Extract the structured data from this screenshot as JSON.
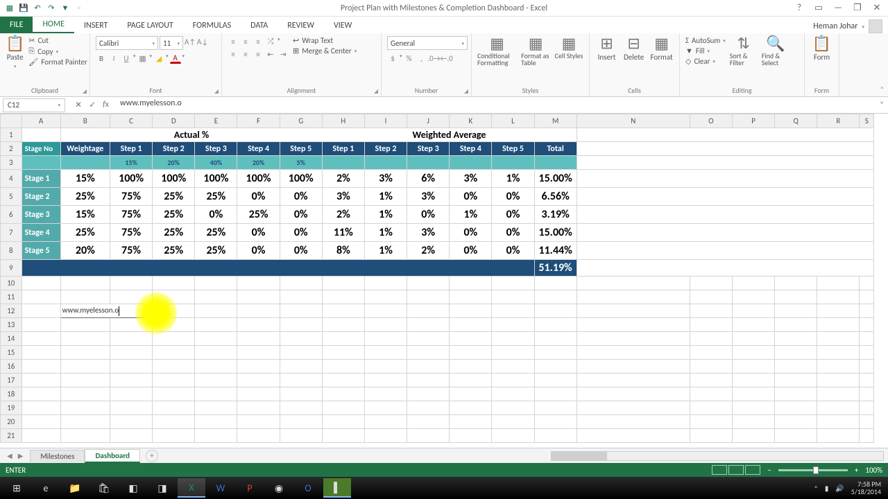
{
  "app": {
    "title": "Project Plan with Milestones & Completion Dashboard - Excel",
    "user": "Heman Johar"
  },
  "tabs": {
    "file": "FILE",
    "items": [
      "HOME",
      "INSERT",
      "PAGE LAYOUT",
      "FORMULAS",
      "DATA",
      "REVIEW",
      "VIEW"
    ],
    "active": 0
  },
  "ribbon": {
    "clipboard": {
      "label": "Clipboard",
      "paste": "Paste",
      "cut": "Cut",
      "copy": "Copy",
      "painter": "Format Painter"
    },
    "font": {
      "label": "Font",
      "name": "Calibri",
      "size": "11"
    },
    "alignment": {
      "label": "Alignment",
      "wrap": "Wrap Text",
      "merge": "Merge & Center"
    },
    "number": {
      "label": "Number",
      "format": "General"
    },
    "styles": {
      "label": "Styles",
      "cond": "Conditional Formatting",
      "table": "Format as Table",
      "cell": "Cell Styles"
    },
    "cells": {
      "label": "Cells",
      "insert": "Insert",
      "delete": "Delete",
      "format": "Format"
    },
    "editing": {
      "label": "Editing",
      "autosum": "AutoSum",
      "fill": "Fill",
      "clear": "Clear",
      "sort": "Sort & Filter",
      "find": "Find & Select"
    },
    "form": {
      "label": "Form",
      "btn": "Form"
    }
  },
  "formula": {
    "cell": "C12",
    "value": "www.myelesson.o"
  },
  "sheet": {
    "columns": [
      "A",
      "B",
      "C",
      "D",
      "E",
      "F",
      "G",
      "H",
      "I",
      "J",
      "K",
      "L",
      "M",
      "N",
      "O",
      "P",
      "Q",
      "R",
      "S"
    ],
    "section_actual": "Actual %",
    "section_weighted": "Weighted Average",
    "headers": [
      "Stage No",
      "Weightage",
      "Step 1",
      "Step 2",
      "Step 3",
      "Step 4",
      "Step 5",
      "Step 1",
      "Step 2",
      "Step 3",
      "Step 4",
      "Step 5",
      "Total"
    ],
    "subheaders": [
      "",
      "",
      "15%",
      "20%",
      "40%",
      "20%",
      "5%",
      "",
      "",
      "",
      "",
      "",
      ""
    ],
    "rows": [
      {
        "stage": "Stage 1",
        "w": "15%",
        "a": [
          "100%",
          "100%",
          "100%",
          "100%",
          "100%"
        ],
        "wa": [
          "2%",
          "3%",
          "6%",
          "3%",
          "1%"
        ],
        "total": "15.00%"
      },
      {
        "stage": "Stage 2",
        "w": "25%",
        "a": [
          "75%",
          "25%",
          "25%",
          "0%",
          "0%"
        ],
        "wa": [
          "3%",
          "1%",
          "3%",
          "0%",
          "0%"
        ],
        "total": "6.56%"
      },
      {
        "stage": "Stage 3",
        "w": "15%",
        "a": [
          "75%",
          "25%",
          "0%",
          "25%",
          "0%"
        ],
        "wa": [
          "2%",
          "1%",
          "0%",
          "1%",
          "0%"
        ],
        "total": "3.19%"
      },
      {
        "stage": "Stage 4",
        "w": "25%",
        "a": [
          "75%",
          "25%",
          "25%",
          "0%",
          "0%"
        ],
        "wa": [
          "11%",
          "1%",
          "3%",
          "0%",
          "0%"
        ],
        "total": "15.00%"
      },
      {
        "stage": "Stage 5",
        "w": "20%",
        "a": [
          "75%",
          "25%",
          "25%",
          "0%",
          "0%"
        ],
        "wa": [
          "8%",
          "1%",
          "2%",
          "0%",
          "0%"
        ],
        "total": "11.44%"
      }
    ],
    "grand_total": "51.19%",
    "editing_value": "www.myelesson.o"
  },
  "sheets": {
    "items": [
      "Milestones",
      "Dashboard"
    ],
    "active": 1
  },
  "status": {
    "mode": "ENTER",
    "zoom": "100%"
  },
  "taskbar": {
    "time": "7:58 PM",
    "date": "5/18/2014"
  }
}
